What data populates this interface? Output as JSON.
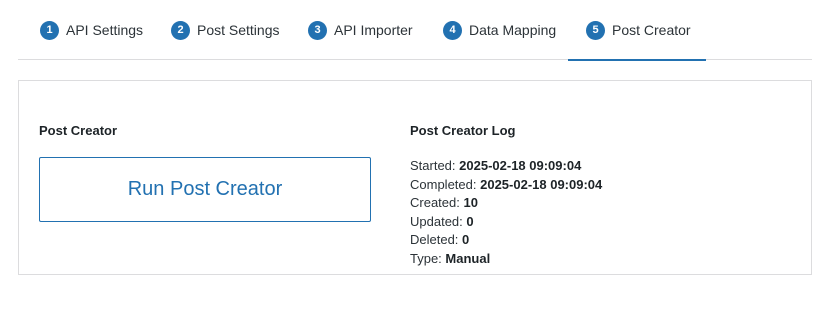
{
  "tabs": [
    {
      "num": "1",
      "label": "API Settings"
    },
    {
      "num": "2",
      "label": "Post Settings"
    },
    {
      "num": "3",
      "label": "API Importer"
    },
    {
      "num": "4",
      "label": "Data Mapping"
    },
    {
      "num": "5",
      "label": "Post Creator"
    }
  ],
  "active_tab": "Post Creator",
  "creator": {
    "heading": "Post Creator",
    "button_label": "Run Post Creator"
  },
  "log": {
    "heading": "Post Creator Log",
    "entries": [
      {
        "label": "Started:",
        "value": "2025-02-18 09:09:04"
      },
      {
        "label": "Completed:",
        "value": "2025-02-18 09:09:04"
      },
      {
        "label": "Created:",
        "value": "10"
      },
      {
        "label": "Updated:",
        "value": "0"
      },
      {
        "label": "Deleted:",
        "value": "0"
      },
      {
        "label": "Type:",
        "value": "Manual"
      }
    ]
  },
  "colors": {
    "accent": "#2271b1",
    "border": "#dcdcde",
    "text": "#1d2327"
  }
}
